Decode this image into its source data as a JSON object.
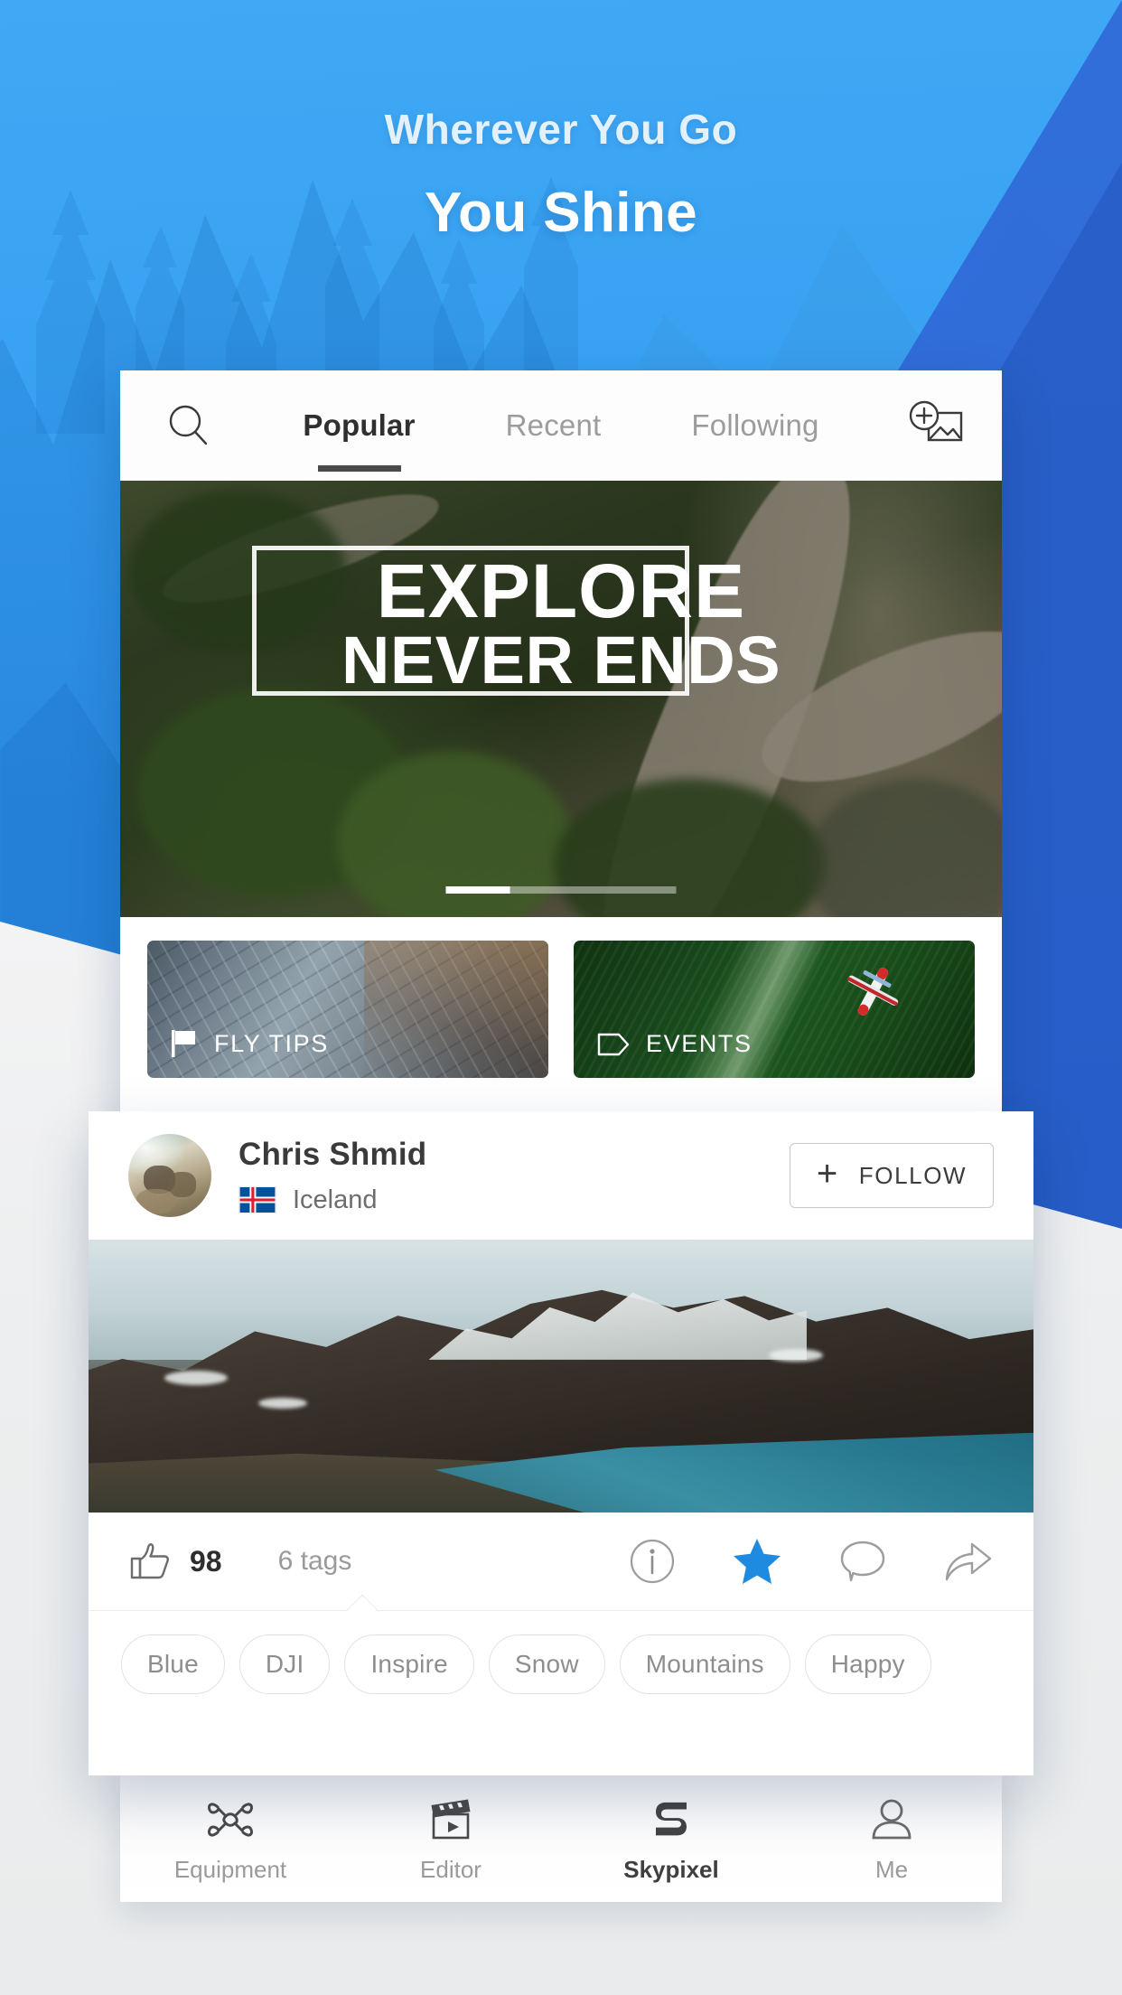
{
  "promo": {
    "subtitle": "Wherever You Go",
    "title": "You Shine"
  },
  "theme": {
    "sky_blue": "#3fa9f5",
    "deep_blue": "#2f66d6",
    "accent_blue": "#1e90e8",
    "star_blue": "#1e8ae0",
    "text_dark": "#2f2f2f",
    "text_muted": "#9c9c9c"
  },
  "app_card": {
    "tabbar": {
      "search_icon": "search-icon",
      "upload_icon": "add-photo-icon",
      "tabs": [
        {
          "label": "Popular",
          "active": true
        },
        {
          "label": "Recent",
          "active": false
        },
        {
          "label": "Following",
          "active": false
        }
      ]
    },
    "hero": {
      "line1": "EXPLORE",
      "line2": "NEVER ENDS",
      "carousel": {
        "total_segments": 4,
        "active_index": 0
      }
    },
    "categories": [
      {
        "label": "FLY TIPS",
        "icon": "flag-icon"
      },
      {
        "label": "EVENTS",
        "icon": "tag-icon"
      }
    ]
  },
  "feed_card": {
    "user": {
      "name": "Chris Shmid",
      "location": "Iceland",
      "flag_icon": "iceland-flag-icon",
      "avatar_icon": "avatar"
    },
    "follow_button": {
      "label": "FOLLOW",
      "icon": "plus-icon"
    },
    "actions": {
      "like_icon": "thumbs-up-icon",
      "like_count": "98",
      "tags_count": "6 tags",
      "icons": [
        {
          "name": "info-icon",
          "active": false
        },
        {
          "name": "star-icon",
          "active": true
        },
        {
          "name": "comment-icon",
          "active": false
        },
        {
          "name": "share-icon",
          "active": false
        }
      ]
    },
    "tags": [
      "Blue",
      "DJI",
      "Inspire",
      "Snow",
      "Mountains",
      "Happy"
    ]
  },
  "bottom_nav": [
    {
      "label": "Equipment",
      "icon": "drone-icon",
      "active": false
    },
    {
      "label": "Editor",
      "icon": "clapperboard-icon",
      "active": false
    },
    {
      "label": "Skypixel",
      "icon": "skypixel-logo-icon",
      "active": true
    },
    {
      "label": "Me",
      "icon": "person-icon",
      "active": false
    }
  ]
}
